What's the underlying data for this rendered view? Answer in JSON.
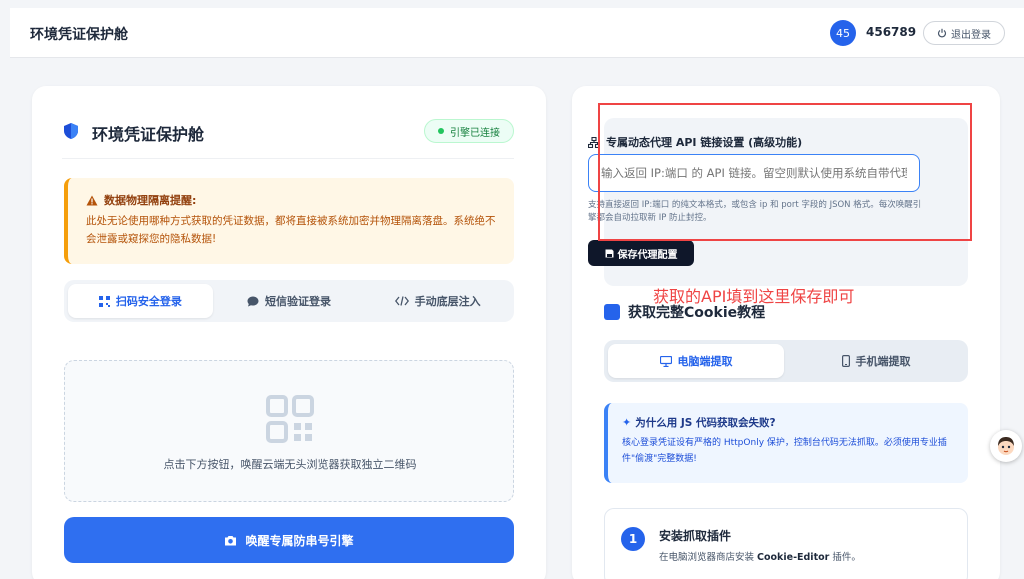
{
  "header": {
    "app_title": "环境凭证保护舱",
    "user_badge": "45",
    "username": "456789",
    "logout_label": "退出登录"
  },
  "left_card": {
    "title": "环境凭证保护舱",
    "status_label": "引擎已连接",
    "warning": {
      "title": "数据物理隔离提醒:",
      "text": "此处无论使用哪种方式获取的凭证数据，都将直接被系统加密并物理隔离落盘。系统绝不会泄露或窥探您的隐私数据!"
    },
    "tabs": [
      {
        "label": "扫码安全登录",
        "active": true
      },
      {
        "label": "短信验证登录",
        "active": false
      },
      {
        "label": "手动底层注入",
        "active": false
      }
    ],
    "qr_caption": "点击下方按钮，唤醒云端无头浏览器获取独立二维码",
    "awake_button": "唤醒专属防串号引擎"
  },
  "right_card": {
    "proxy": {
      "title": "专属动态代理 API 链接设置 (高级功能)",
      "input_placeholder": "输入返回 IP:端口 的 API 链接。留空则默认使用系统自带代理/",
      "hint": "支持直接返回 IP:端口 的纯文本格式，或包含 ip 和 port 字段的 JSON 格式。每次唤醒引擎都会自动拉取新 IP 防止封控。",
      "save_button": "保存代理配置"
    },
    "annotation": "获取的API填到这里保存即可",
    "tutorial_title": "获取完整Cookie教程",
    "device_tabs": [
      {
        "label": "电脑端提取",
        "active": true
      },
      {
        "label": "手机端提取",
        "active": false
      }
    ],
    "info": {
      "title": "为什么用 JS 代码获取会失败?",
      "text": "核心登录凭证设有严格的 HttpOnly 保护，控制台代码无法抓取。必须使用专业插件\"偷渡\"完整数据!"
    },
    "step": {
      "number": "1",
      "title": "安装抓取插件",
      "desc_prefix": "在电脑浏览器商店安装 ",
      "desc_bold": "Cookie-Editor",
      "desc_suffix": " 插件。"
    }
  },
  "colors": {
    "accent": "#2563eb",
    "warning": "#f59e0b",
    "success": "#22c55e",
    "annotation": "#ef4444"
  }
}
